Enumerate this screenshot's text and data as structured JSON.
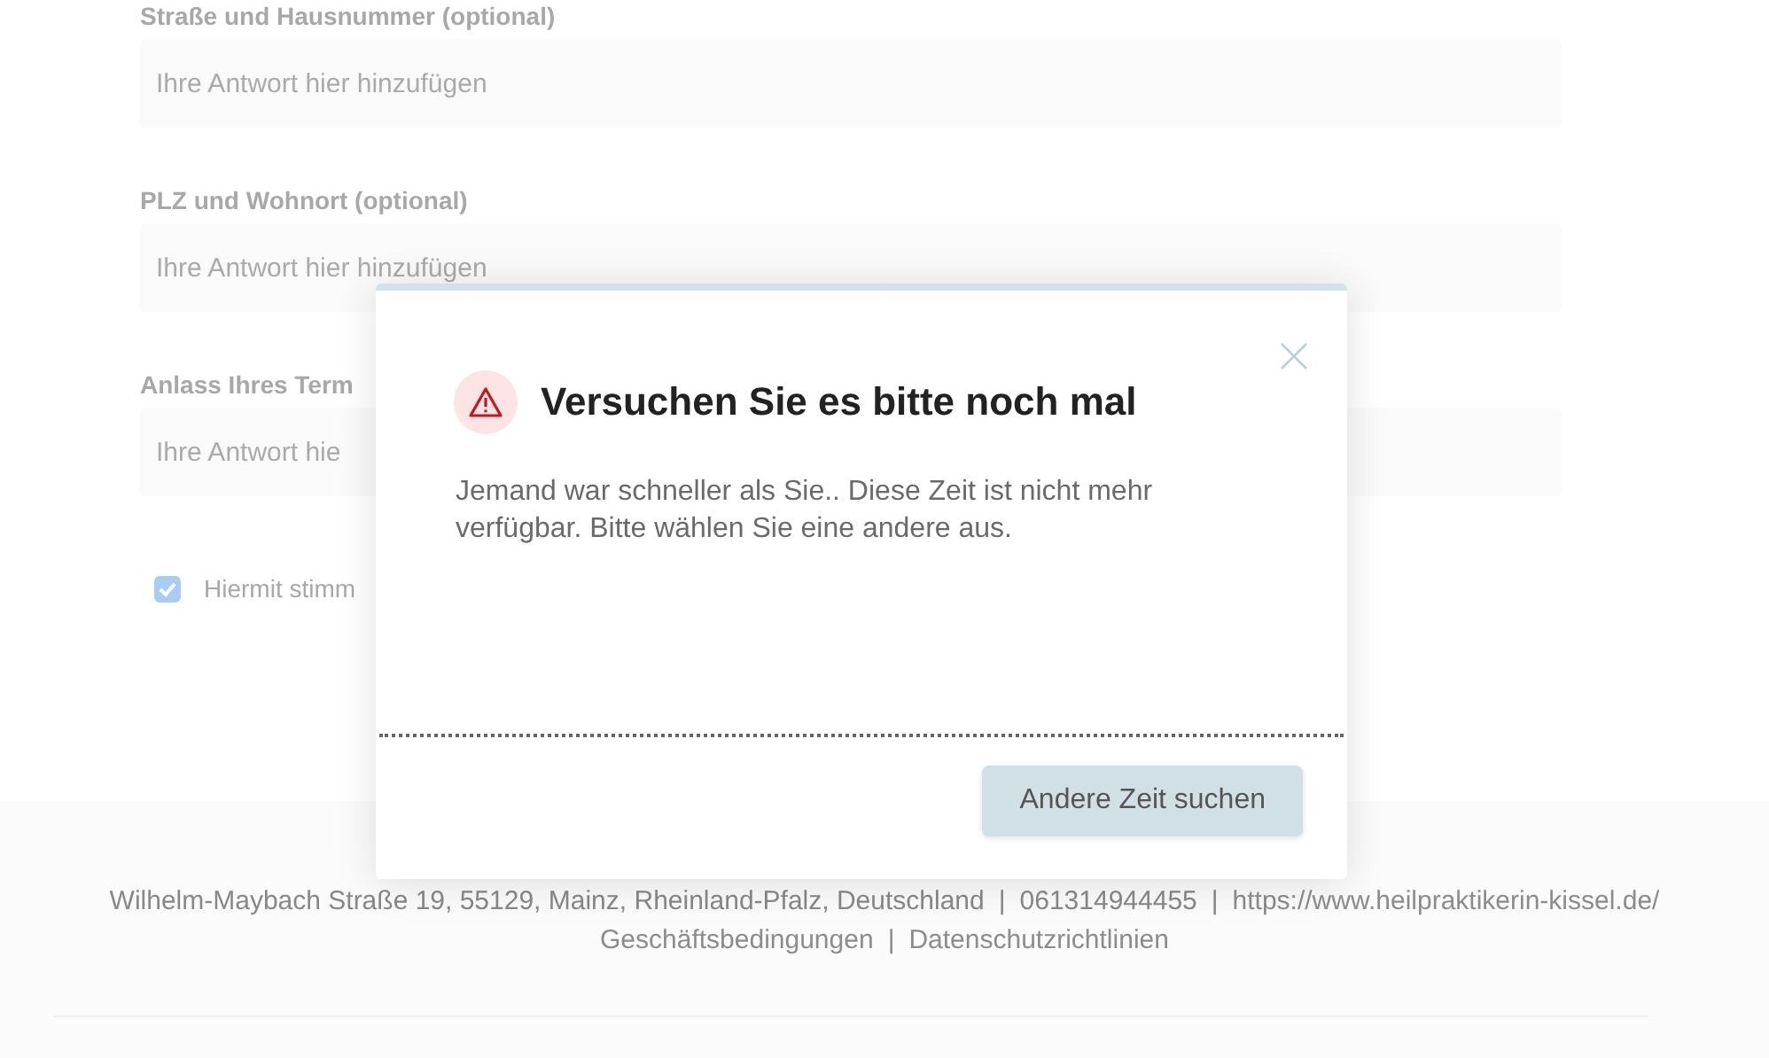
{
  "form": {
    "fields": [
      {
        "label": "Straße und Hausnummer (optional)",
        "placeholder": "Ihre Antwort hier hinzufügen"
      },
      {
        "label": "PLZ und Wohnort (optional)",
        "placeholder": "Ihre Antwort hier hinzufügen"
      },
      {
        "label": "Anlass Ihres Term",
        "placeholder": "Ihre Antwort hie"
      }
    ],
    "consent": {
      "label": "Hiermit stimm",
      "checked": true
    }
  },
  "footer": {
    "address": "Wilhelm-Maybach Straße 19, 55129, Mainz, Rheinland-Pfalz, Deutschland",
    "separator_1": "|",
    "phone": "061314944455",
    "separator_2": "|",
    "website": "https://www.heilpraktikerin-kissel.de/",
    "links": [
      "Geschäftsbedingungen",
      "Datenschutzrichtlinien"
    ],
    "link_separator": "|"
  },
  "dialog": {
    "title": "Versuchen Sie es bitte noch mal",
    "message": "Jemand war schneller als Sie.. Diese Zeit ist nicht mehr verfügbar. Bitte wählen Sie eine andere aus.",
    "button": "Andere Zeit suchen"
  }
}
